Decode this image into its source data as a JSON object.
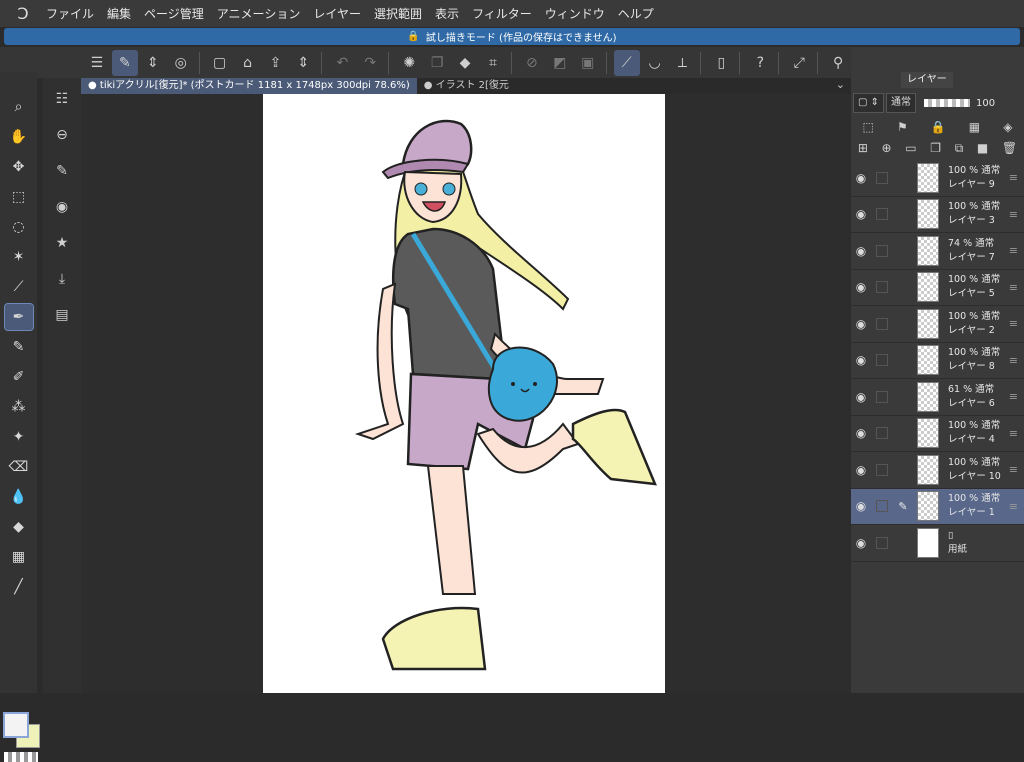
{
  "menu": [
    "ファイル",
    "編集",
    "ページ管理",
    "アニメーション",
    "レイヤー",
    "選択範囲",
    "表示",
    "フィルター",
    "ウィンドウ",
    "ヘルプ"
  ],
  "banner": "試し描きモード (作品の保存はできません)",
  "tabs": [
    {
      "label": "● tikiアクリル[復元]* (ポストカード 1181 x 1748px 300dpi 78.6%)"
    },
    {
      "label": "● イラスト 2[復元"
    }
  ],
  "right_panel": {
    "tab_label": "レイヤー",
    "blend_mode": "通常",
    "opacity": "100"
  },
  "layers": [
    {
      "opacity": "100 %",
      "mode": "通常",
      "name": "レイヤー 9",
      "selected": false
    },
    {
      "opacity": "100 %",
      "mode": "通常",
      "name": "レイヤー 3",
      "selected": false
    },
    {
      "opacity": "74 %",
      "mode": "通常",
      "name": "レイヤー 7",
      "selected": false
    },
    {
      "opacity": "100 %",
      "mode": "通常",
      "name": "レイヤー 5",
      "selected": false
    },
    {
      "opacity": "100 %",
      "mode": "通常",
      "name": "レイヤー 2",
      "selected": false
    },
    {
      "opacity": "100 %",
      "mode": "通常",
      "name": "レイヤー 8",
      "selected": false
    },
    {
      "opacity": "61 %",
      "mode": "通常",
      "name": "レイヤー 6",
      "selected": false
    },
    {
      "opacity": "100 %",
      "mode": "通常",
      "name": "レイヤー 4",
      "selected": false
    },
    {
      "opacity": "100 %",
      "mode": "通常",
      "name": "レイヤー 10",
      "selected": false
    },
    {
      "opacity": "100 %",
      "mode": "通常",
      "name": "レイヤー 1",
      "selected": true
    }
  ],
  "paper_layer": {
    "name": "用紙"
  },
  "colors": {
    "accent": "#4b5a76",
    "banner": "#2f6aa6",
    "selected_layer": "#58678a"
  }
}
